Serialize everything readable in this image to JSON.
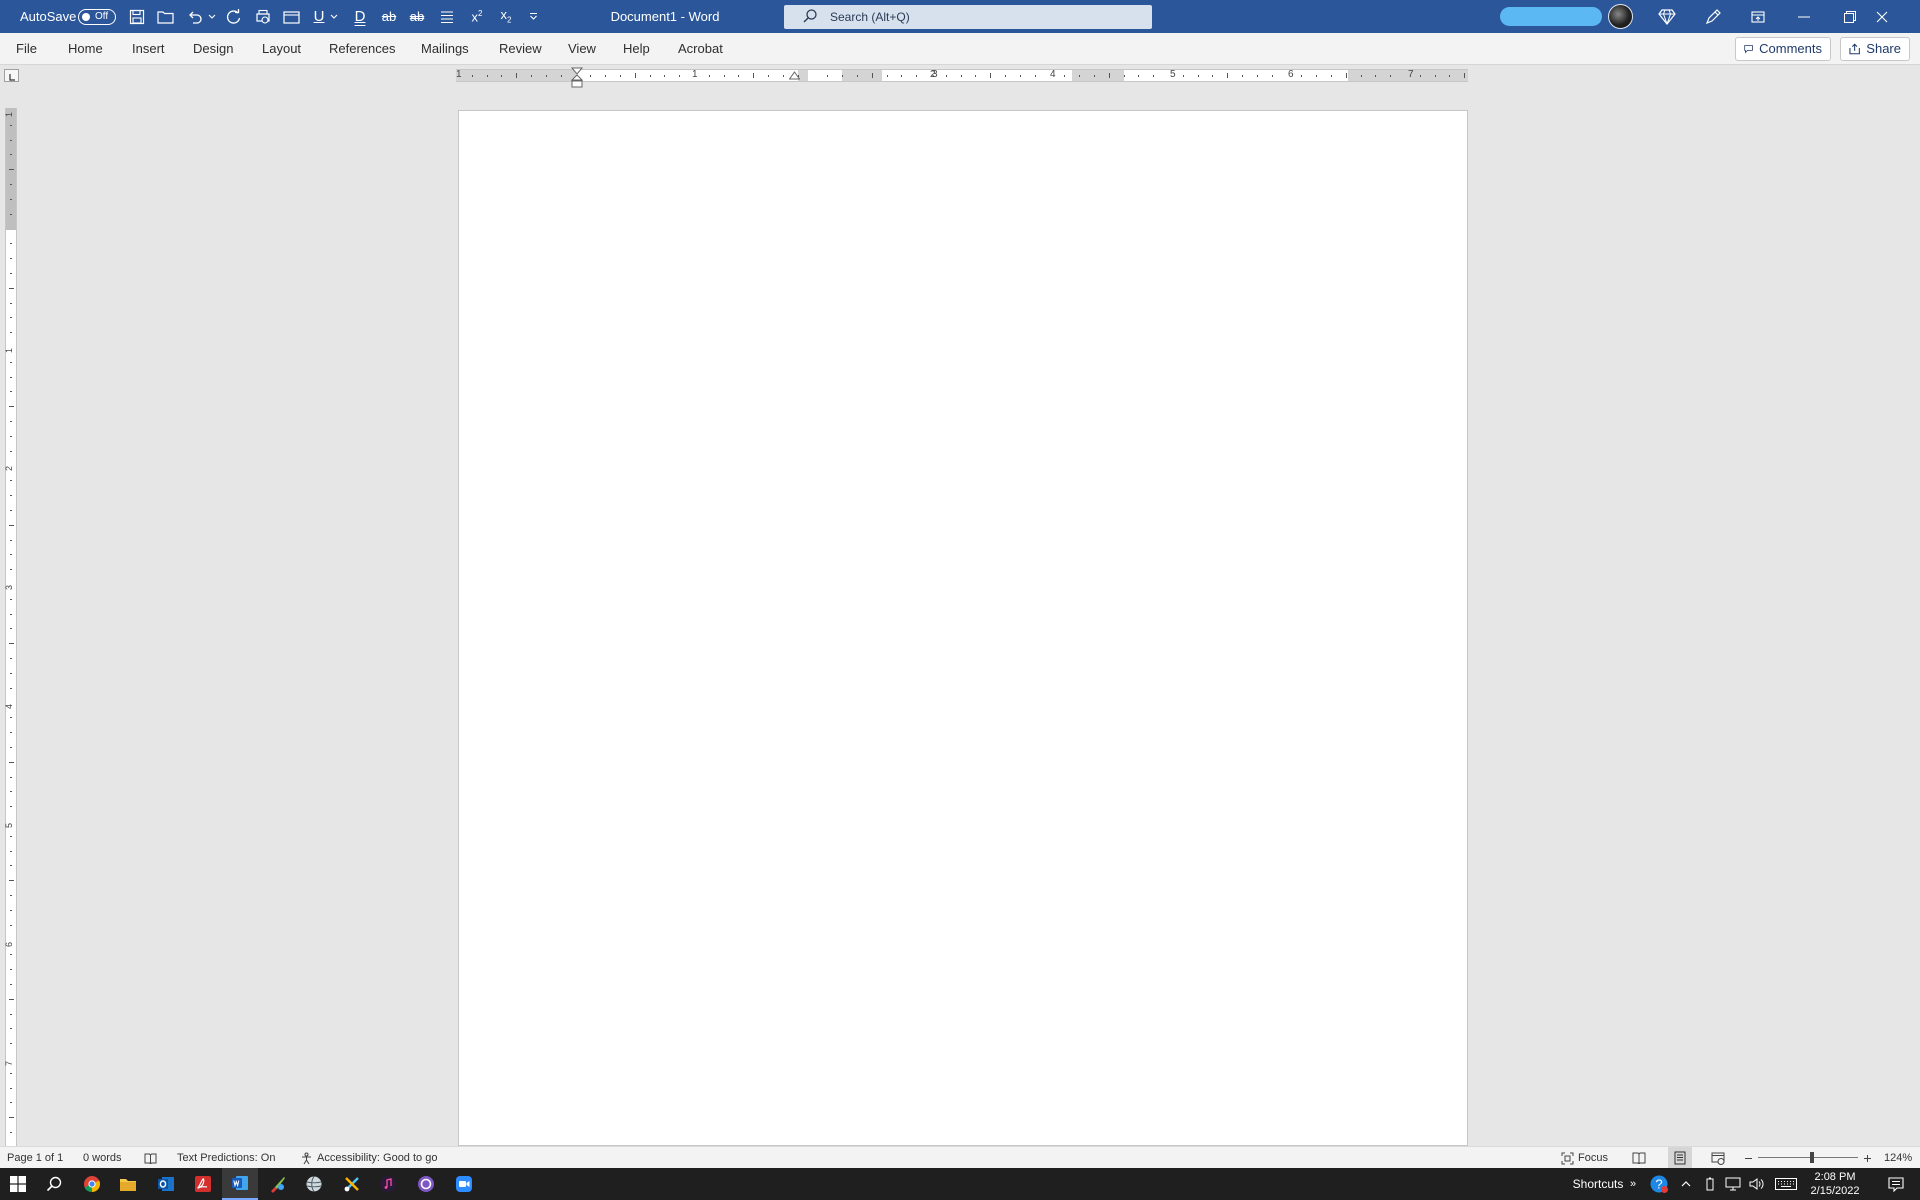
{
  "titlebar": {
    "autosave_label": "AutoSave",
    "autosave_state": "Off",
    "doc_title": "Document1  -  Word",
    "search_placeholder": "Search (Alt+Q)",
    "bg_color": "#2b579a"
  },
  "ribbon": {
    "tabs": [
      "File",
      "Home",
      "Insert",
      "Design",
      "Layout",
      "References",
      "Mailings",
      "Review",
      "View",
      "Help",
      "Acrobat"
    ],
    "comments_label": "Comments",
    "share_label": "Share"
  },
  "ruler": {
    "h_numbers": [
      "1",
      "1",
      "2",
      "3",
      "4",
      "5",
      "6",
      "7"
    ],
    "v_numbers": [
      "1",
      "1",
      "2",
      "3",
      "4",
      "5",
      "6",
      "7"
    ]
  },
  "statusbar": {
    "page": "Page 1 of 1",
    "words": "0 words",
    "text_predictions": "Text Predictions: On",
    "accessibility": "Accessibility: Good to go",
    "focus": "Focus",
    "zoom": "124%"
  },
  "taskbar": {
    "shortcuts_label": "Shortcuts",
    "time": "2:08 PM",
    "date": "2/15/2022"
  }
}
